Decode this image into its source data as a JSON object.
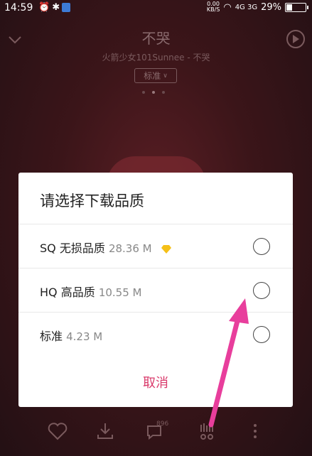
{
  "status_bar": {
    "time": "14:59",
    "net_speed_value": "0.00",
    "net_speed_unit": "KB/S",
    "signal": "4G 3G",
    "battery": "29%",
    "battery_level": 0.29
  },
  "player": {
    "song_title": "不哭",
    "artist": "火箭少女101Sunnee - 不哭",
    "quality_label": "标准"
  },
  "dialog": {
    "title": "请选择下载品质",
    "options": [
      {
        "label": "SQ 无损品质",
        "size": "28.36 M",
        "premium": true
      },
      {
        "label": "HQ 高品质",
        "size": "10.55 M",
        "premium": false
      },
      {
        "label": "标准",
        "size": "4.23 M",
        "premium": false
      }
    ],
    "cancel_label": "取消"
  },
  "toolbar": {
    "comment_count": "896"
  },
  "colors": {
    "accent": "#d93a6b",
    "arrow": "#e83e9c",
    "premium": "#f5c018"
  }
}
